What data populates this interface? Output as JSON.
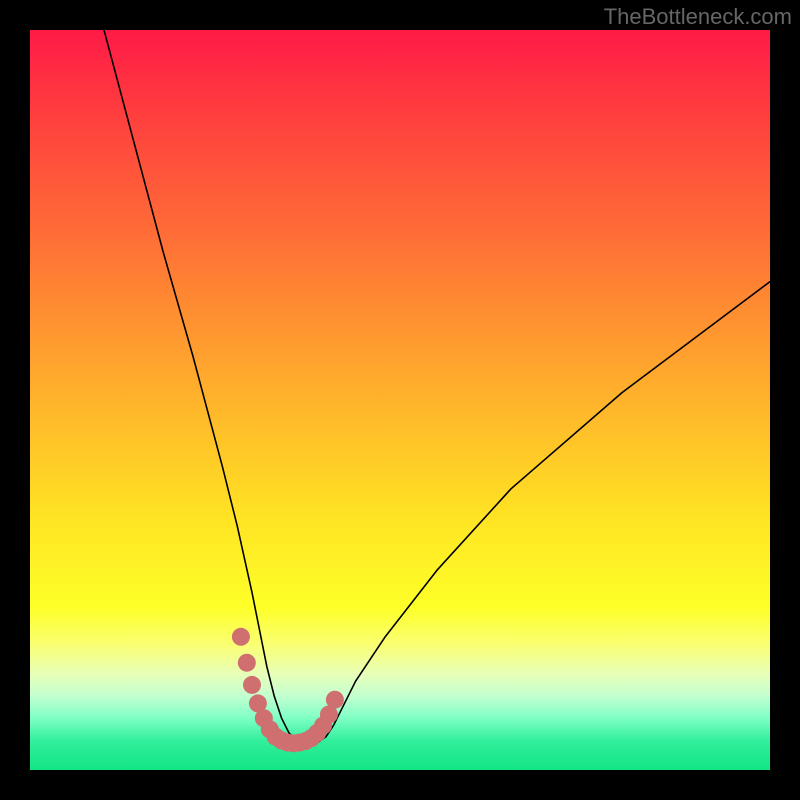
{
  "watermark": "TheBottleneck.com",
  "chart_data": {
    "type": "line",
    "title": "",
    "xlabel": "",
    "ylabel": "",
    "xlim": [
      0,
      100
    ],
    "ylim": [
      0,
      100
    ],
    "series": [
      {
        "name": "curve",
        "x": [
          10,
          14,
          18,
          22,
          26,
          28,
          30,
          31,
          32,
          33,
          34,
          35,
          36,
          37,
          38,
          38.5,
          39,
          40,
          41,
          42,
          44,
          48,
          55,
          65,
          80,
          100
        ],
        "values": [
          100,
          85,
          70,
          56,
          41,
          33,
          24,
          19,
          14,
          10,
          7,
          5,
          4,
          3.5,
          3.5,
          3.6,
          3.8,
          4.5,
          6,
          8,
          12,
          18,
          27,
          38,
          51,
          66
        ]
      }
    ],
    "highlight": {
      "name": "marker-band",
      "color": "#cf6f70",
      "x": [
        28.5,
        29.3,
        30.0,
        30.8,
        31.6,
        32.4,
        33.2,
        34.0,
        34.8,
        35.6,
        36.4,
        37.2,
        38.0,
        38.8,
        39.6,
        40.4,
        41.2
      ],
      "values": [
        18.0,
        14.5,
        11.5,
        9.0,
        7.0,
        5.5,
        4.5,
        4.0,
        3.7,
        3.6,
        3.7,
        3.9,
        4.3,
        5.0,
        6.0,
        7.5,
        9.5
      ]
    },
    "gradient_background": {
      "top": "#ff1744",
      "mid": "#ffd500",
      "bottom": "#13e583"
    }
  }
}
